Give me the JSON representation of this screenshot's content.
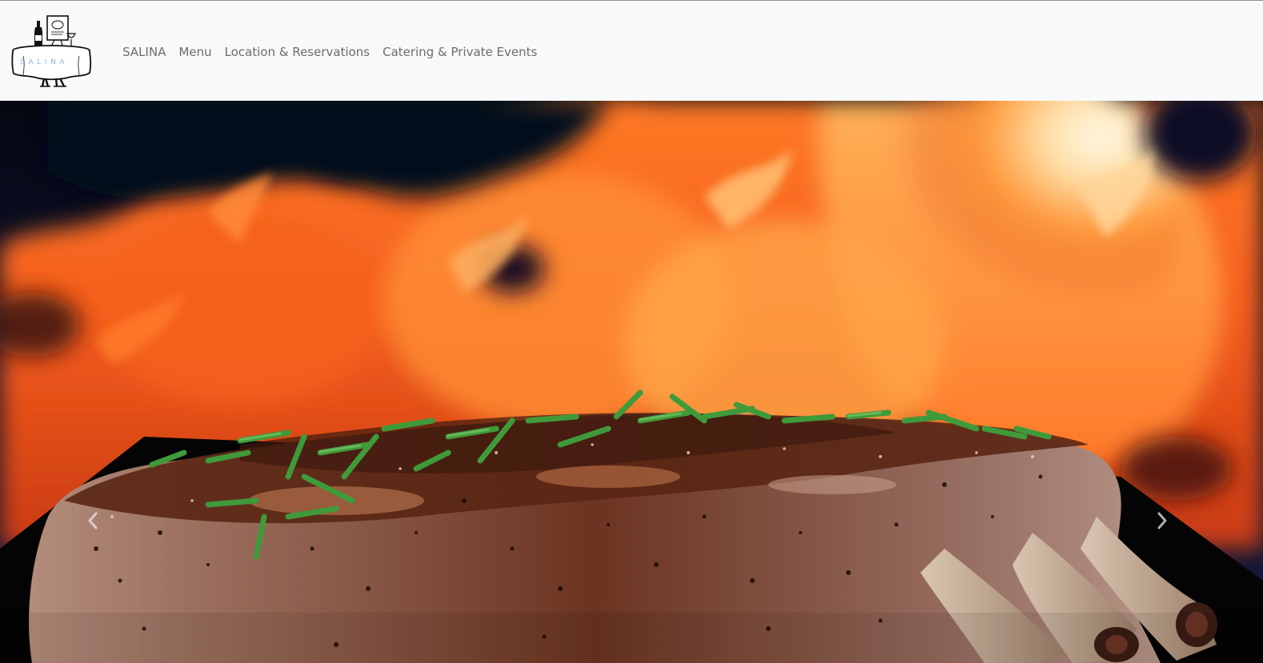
{
  "brand": {
    "logo_text": "SALINA",
    "logo_icon": "restaurant-table-logo"
  },
  "nav": {
    "items": [
      {
        "label": "SALINA"
      },
      {
        "label": "Menu"
      },
      {
        "label": "Location & Reservations"
      },
      {
        "label": "Catering & Private Events"
      }
    ]
  },
  "hero": {
    "image_subject": "roasted rack of pork with chives in front of flames",
    "controls": {
      "prev_icon": "chevron-left-icon",
      "next_icon": "chevron-right-icon"
    }
  },
  "colors": {
    "navbar_bg": "#f8f9fa",
    "nav_link": "#6c6c6c",
    "logo_lettering": "#8fb3ea"
  }
}
